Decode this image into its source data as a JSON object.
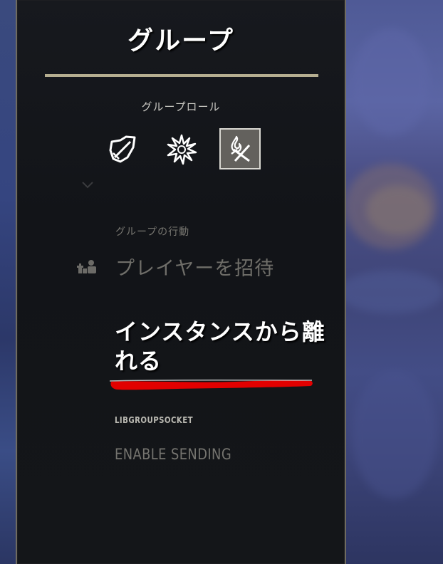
{
  "panel": {
    "title": "グループ"
  },
  "group_role": {
    "heading": "グループロール",
    "roles": [
      {
        "icon": "tank-shield-sword-icon",
        "selected": false
      },
      {
        "icon": "healer-burst-icon",
        "selected": false
      },
      {
        "icon": "dps-flame-swords-icon",
        "selected": true
      }
    ]
  },
  "group_actions": {
    "heading": "グループの行動",
    "invite_label": "プレイヤーを招待",
    "leave_instance_label": "インスタンスから離れる"
  },
  "libgroupsocket": {
    "heading": "LIBGROUPSOCKET",
    "enable_sending_label": "ENABLE SENDING"
  },
  "colors": {
    "panel_bg": "#141619",
    "divider": "#b5ae90",
    "highlight_underline": "#e00000",
    "selected_role_bg": "#63615d"
  }
}
